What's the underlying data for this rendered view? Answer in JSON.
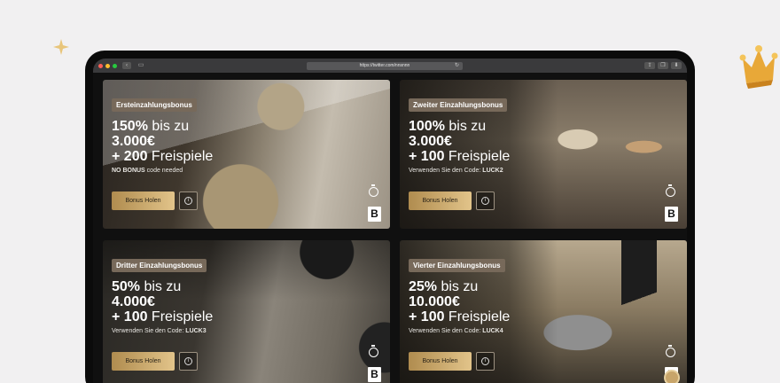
{
  "browser": {
    "url": "https://twitter.com/nnsnnn",
    "traffic_lights": [
      "#ff5f56",
      "#ffbd2e",
      "#27c93f"
    ]
  },
  "cards": [
    {
      "badge": "Ersteinzahlungsbonus",
      "line1_bold": "150%",
      "line1_light": " bis zu",
      "line2": "3.000€",
      "line3_bold": "+ 200",
      "line3_light": " Freispiele",
      "note_bold": "NO BONUS",
      "note_text": " code needed",
      "cta_label": "Bonus Holen",
      "logo": "B"
    },
    {
      "badge": "Zweiter Einzahlungsbonus",
      "line1_bold": "100%",
      "line1_light": " bis zu",
      "line2": "3.000€",
      "line3_bold": "+ 100",
      "line3_light": " Freispiele",
      "note_text": "Verwenden Sie den Code: ",
      "note_bold": "LUCK2",
      "cta_label": "Bonus Holen",
      "logo": "B"
    },
    {
      "badge": "Dritter Einzahlungsbonus",
      "line1_bold": "50%",
      "line1_light": " bis zu",
      "line2": "4.000€",
      "line3_bold": "+ 100",
      "line3_light": " Freispiele",
      "note_text": "Verwenden Sie den Code: ",
      "note_bold": "LUCK3",
      "cta_label": "Bonus Holen",
      "logo": "B"
    },
    {
      "badge": "Vierter Einzahlungsbonus",
      "line1_bold": "25%",
      "line1_light": " bis zu",
      "line2": "10.000€",
      "line3_bold": "+ 100",
      "line3_light": " Freispiele",
      "note_text": "Verwenden Sie den Code: ",
      "note_bold": "LUCK4",
      "cta_label": "Bonus Holen",
      "logo": "B"
    }
  ],
  "colors": {
    "accent_gold": "#c9a869",
    "badge_bg": "#77695a"
  }
}
